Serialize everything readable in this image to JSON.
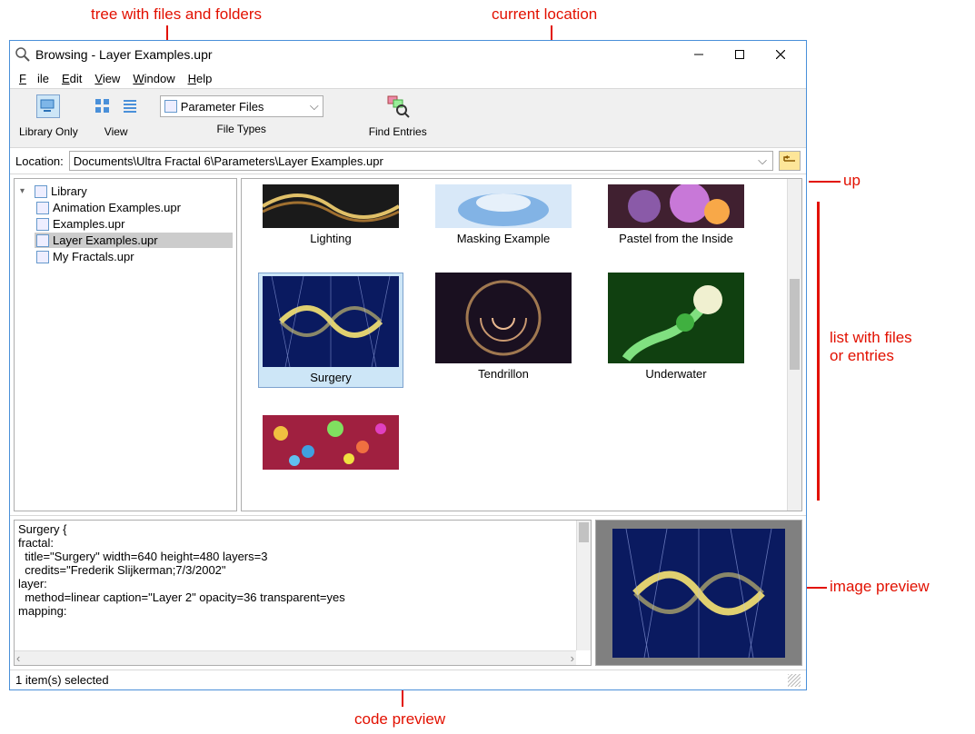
{
  "title": "Browsing - Layer Examples.upr",
  "menu": {
    "file": "File",
    "edit": "Edit",
    "view": "View",
    "window": "Window",
    "help": "Help"
  },
  "toolbar": {
    "library_only": "Library Only",
    "view": "View",
    "file_types": "File Types",
    "file_types_value": "Parameter Files",
    "find_entries": "Find Entries"
  },
  "location": {
    "label": "Location:",
    "path": "Documents\\Ultra Fractal 6\\Parameters\\Layer Examples.upr"
  },
  "tree": {
    "root": "Library",
    "items": [
      "Animation Examples.upr",
      "Examples.upr",
      "Layer Examples.upr",
      "My Fractals.upr"
    ],
    "selected_index": 2
  },
  "thumbs": {
    "row1": [
      "Lighting",
      "Masking Example",
      "Pastel from the Inside"
    ],
    "row2": [
      "Surgery",
      "Tendrillon",
      "Underwater"
    ],
    "selected": "Surgery"
  },
  "code": "Surgery {\nfractal:\n  title=\"Surgery\" width=640 height=480 layers=3\n  credits=\"Frederik Slijkerman;7/3/2002\"\nlayer:\n  method=linear caption=\"Layer 2\" opacity=36 transparent=yes\nmapping:",
  "status": "1 item(s) selected",
  "annotations": {
    "tree": "tree with files and folders",
    "location": "current location",
    "up": "up",
    "list": "list with files\nor entries",
    "image_preview": "image preview",
    "code_preview": "code preview"
  }
}
